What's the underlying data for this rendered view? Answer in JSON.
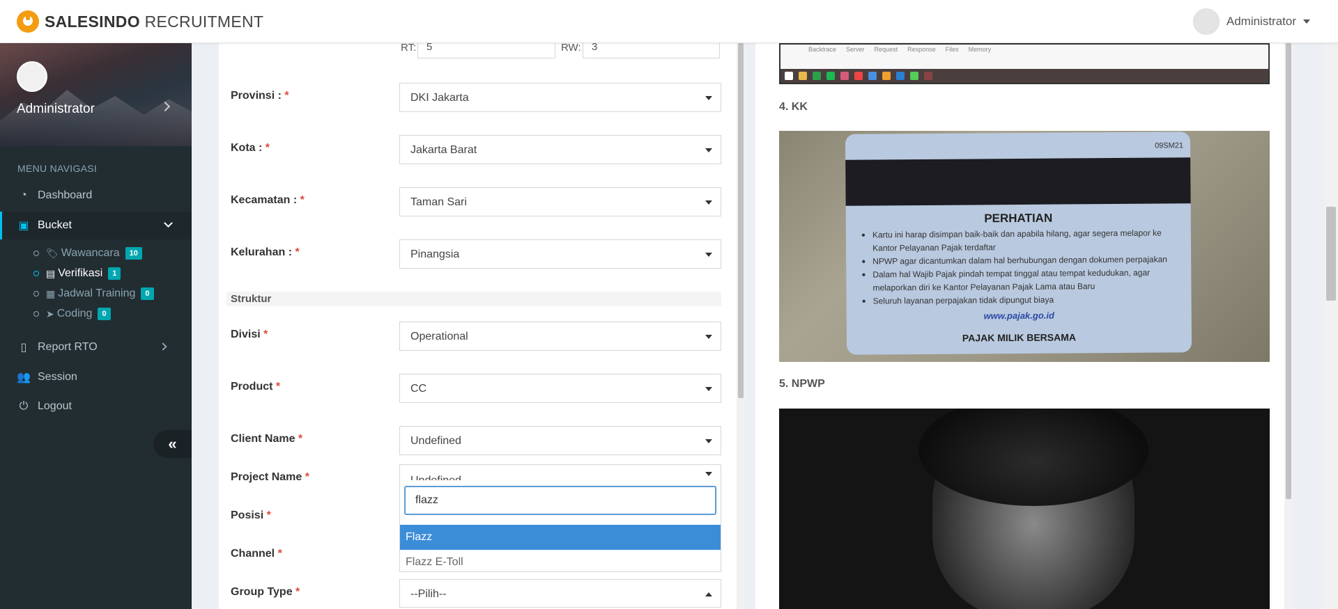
{
  "header": {
    "brand_bold": "SALESINDO",
    "brand_light": " RECRUITMENT",
    "user_name": "Administrator"
  },
  "sidebar": {
    "user_name": "Administrator",
    "nav_header": "MENU NAVIGASI",
    "items": [
      {
        "label": "Dashboard",
        "icon": "dashboard-icon"
      },
      {
        "label": "Bucket",
        "icon": "bucket-icon"
      },
      {
        "label": "Report RTO",
        "icon": "file-icon"
      },
      {
        "label": "Session",
        "icon": "users-icon"
      },
      {
        "label": "Logout",
        "icon": "power-icon"
      }
    ],
    "sub_items": [
      {
        "label": "Wawancara",
        "badge": "10",
        "icon": "tags-icon"
      },
      {
        "label": "Verifikasi",
        "badge": "1",
        "icon": "calendar-check-icon"
      },
      {
        "label": "Jadwal Training",
        "badge": "0",
        "icon": "calendar-icon"
      },
      {
        "label": "Coding",
        "badge": "0",
        "icon": "rocket-icon"
      }
    ],
    "collapse_glyph": "«"
  },
  "form": {
    "rt_label": "RT:",
    "rt_value": "5",
    "rw_label": "RW:",
    "rw_value": "3",
    "fields": [
      {
        "label": "Provinsi : ",
        "value": "DKI Jakarta"
      },
      {
        "label": "Kota : ",
        "value": "Jakarta Barat"
      },
      {
        "label": "Kecamatan : ",
        "value": "Taman Sari"
      },
      {
        "label": "Kelurahan : ",
        "value": "Pinangsia"
      },
      {
        "label": "Divisi ",
        "value": "Operational"
      },
      {
        "label": "Product ",
        "value": "CC"
      },
      {
        "label": "Client Name ",
        "value": "Undefined"
      },
      {
        "label": "Project Name ",
        "value": "Undefined"
      },
      {
        "label": "Posisi ",
        "value": ""
      },
      {
        "label": "Channel ",
        "value": ""
      },
      {
        "label": "Group Type ",
        "value": "--Pilih--"
      }
    ],
    "required_mark": "*",
    "section_struktur": "Struktur",
    "dropdown": {
      "search_value": "flazz",
      "options": [
        "Flazz",
        "Flazz E-Toll"
      ]
    }
  },
  "documents": {
    "kk_heading": "4. KK",
    "npwp_heading": "5. NPWP",
    "screenshot_tabs": [
      "Backtrace",
      "Server",
      "Request",
      "Response",
      "Files",
      "Memory"
    ],
    "npwp_card": {
      "serial": "09SM21",
      "title": "PERHATIAN",
      "bullets": [
        "Kartu ini harap disimpan baik-baik dan apabila hilang, agar segera melapor ke Kantor Pelayanan Pajak terdaftar",
        "NPWP agar dicantumkan dalam hal berhubungan dengan dokumen perpajakan",
        "Dalam hal Wajib Pajak pindah tempat tinggal atau tempat kedudukan, agar melaporkan diri ke Kantor Pelayanan Pajak Lama atau Baru",
        "Seluruh layanan perpajakan tidak dipungut biaya"
      ],
      "url": "www.pajak.go.id",
      "footer": "PAJAK MILIK BERSAMA"
    }
  },
  "colors": {
    "sidebar_bg": "#222d32",
    "accent": "#00c0ef",
    "badge": "#00a7b0",
    "highlight": "#3c8dd8",
    "required": "#dd4b39",
    "brand_orange": "#f39c12"
  }
}
